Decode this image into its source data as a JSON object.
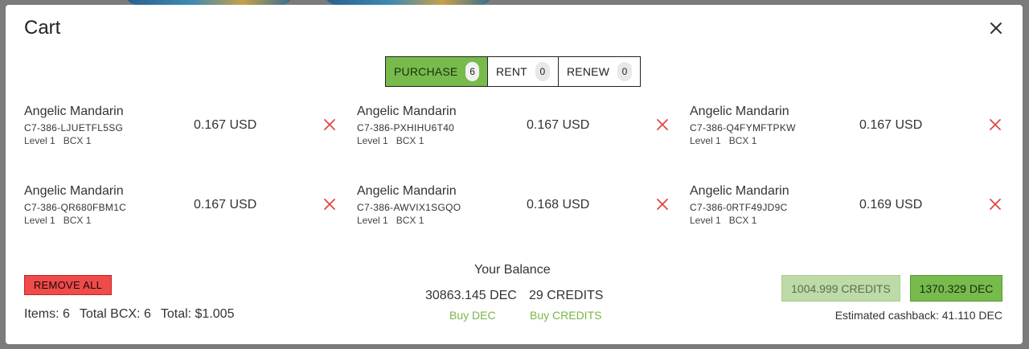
{
  "modal": {
    "title": "Cart"
  },
  "tabs": [
    {
      "label": "PURCHASE",
      "count": "6",
      "active": true
    },
    {
      "label": "RENT",
      "count": "0",
      "active": false
    },
    {
      "label": "RENEW",
      "count": "0",
      "active": false
    }
  ],
  "items": [
    {
      "name": "Angelic Mandarin",
      "code": "C7-386-LJUETFL5SG",
      "level": "Level 1",
      "bcx": "BCX 1",
      "price": "0.167 USD"
    },
    {
      "name": "Angelic Mandarin",
      "code": "C7-386-PXHIHU6T40",
      "level": "Level 1",
      "bcx": "BCX 1",
      "price": "0.167 USD"
    },
    {
      "name": "Angelic Mandarin",
      "code": "C7-386-Q4FYMFTPKW",
      "level": "Level 1",
      "bcx": "BCX 1",
      "price": "0.167 USD"
    },
    {
      "name": "Angelic Mandarin",
      "code": "C7-386-QR680FBM1C",
      "level": "Level 1",
      "bcx": "BCX 1",
      "price": "0.167 USD"
    },
    {
      "name": "Angelic Mandarin",
      "code": "C7-386-AWVIX1SGQO",
      "level": "Level 1",
      "bcx": "BCX 1",
      "price": "0.168 USD"
    },
    {
      "name": "Angelic Mandarin",
      "code": "C7-386-0RTF49JD9C",
      "level": "Level 1",
      "bcx": "BCX 1",
      "price": "0.169 USD"
    }
  ],
  "footer": {
    "remove_all_label": "REMOVE ALL",
    "items_count": "Items: 6",
    "total_bcx": "Total BCX: 6",
    "total": "Total: $1.005"
  },
  "balance": {
    "title": "Your Balance",
    "dec": "30863.145 DEC",
    "credits": "29 CREDITS",
    "buy_dec_label": "Buy DEC",
    "buy_credits_label": "Buy CREDITS"
  },
  "payment": {
    "credits_label": "1004.999 CREDITS",
    "dec_label": "1370.329 DEC",
    "cashback": "Estimated cashback: 41.110 DEC"
  },
  "colors": {
    "accent_green": "#76bb4c",
    "danger_red": "#ee4b4b",
    "link_green": "#7ab648"
  },
  "icons": {
    "close": "close-icon",
    "remove_item": "x-icon"
  }
}
